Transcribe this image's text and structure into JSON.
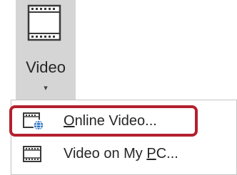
{
  "ribbon": {
    "video_button": {
      "label": "Video",
      "icon": "film-strip-icon",
      "arrow": "▾"
    }
  },
  "menu": {
    "items": [
      {
        "mnemonic": "O",
        "rest": "nline Video...",
        "icon": "online-video-icon",
        "highlighted": true
      },
      {
        "prefix": "Video on My ",
        "mnemonic": "P",
        "rest": "C...",
        "icon": "film-strip-icon"
      }
    ]
  },
  "colors": {
    "button_background": "#d5d5d5",
    "highlight_ring": "#b4202e",
    "globe_blue": "#2b74c6",
    "text": "#262626"
  }
}
